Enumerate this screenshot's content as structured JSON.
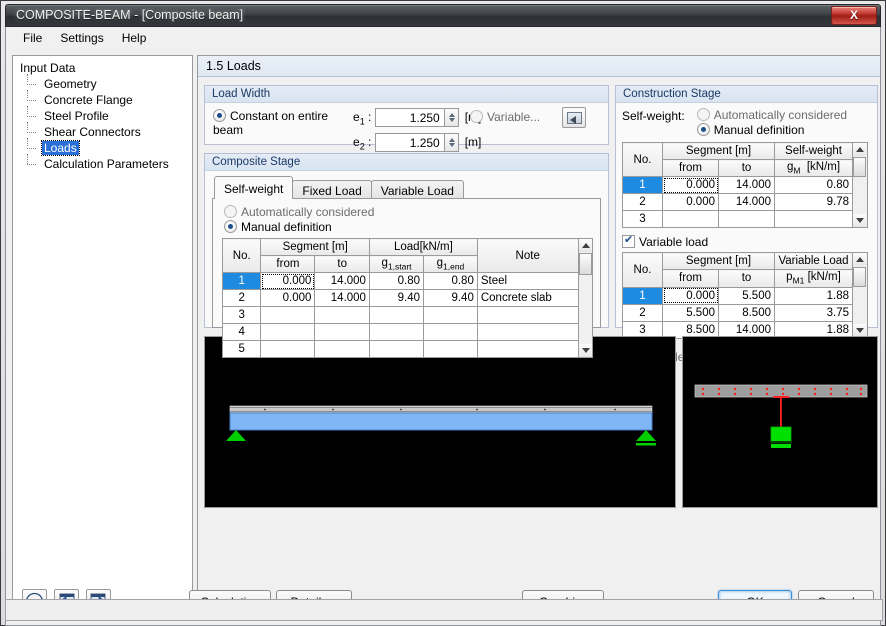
{
  "window": {
    "title": "COMPOSITE-BEAM - [Composite beam]",
    "close_label": "X"
  },
  "menu": {
    "items": [
      "File",
      "Settings",
      "Help"
    ]
  },
  "sidebar": {
    "root": "Input Data",
    "items": [
      {
        "label": "Geometry",
        "selected": false
      },
      {
        "label": "Concrete Flange",
        "selected": false
      },
      {
        "label": "Steel Profile",
        "selected": false
      },
      {
        "label": "Shear Connectors",
        "selected": false
      },
      {
        "label": "Loads",
        "selected": true
      },
      {
        "label": "Calculation Parameters",
        "selected": false
      }
    ]
  },
  "page": {
    "header": "1.5 Loads"
  },
  "load_width": {
    "title": "Load Width",
    "constant_label": "Constant on entire beam",
    "constant_selected": true,
    "e1_label": "e",
    "e1_sub": "1",
    "e1_colon": ":",
    "e1_value": "1.250",
    "e1_unit": "[m]",
    "e2_label": "e",
    "e2_sub": "2",
    "e2_colon": ":",
    "e2_value": "1.250",
    "e2_unit": "[m]",
    "variable_label": "Variable...",
    "variable_selected": false,
    "picker_icon": "picker-icon"
  },
  "composite_stage": {
    "title": "Composite Stage",
    "tabs": [
      {
        "label": "Self-weight",
        "active": true
      },
      {
        "label": "Fixed Load",
        "active": false
      },
      {
        "label": "Variable Load",
        "active": false
      }
    ],
    "auto_label": "Automatically considered",
    "auto_selected": false,
    "manual_label": "Manual definition",
    "manual_selected": true,
    "table": {
      "group_headers": [
        "Segment [m]",
        "Load[kN/m]"
      ],
      "headers": {
        "no": "No.",
        "from": "from",
        "to": "to",
        "g_start_main": "g",
        "g_start_sub": "1,start",
        "g_end_main": "g",
        "g_end_sub": "1,end",
        "note": "Note"
      },
      "rows": [
        {
          "no": "1",
          "from": "0.000",
          "to": "14.000",
          "g_start": "0.80",
          "g_end": "0.80",
          "note": "Steel",
          "selected": true
        },
        {
          "no": "2",
          "from": "0.000",
          "to": "14.000",
          "g_start": "9.40",
          "g_end": "9.40",
          "note": "Concrete slab",
          "selected": false
        },
        {
          "no": "3",
          "from": "",
          "to": "",
          "g_start": "",
          "g_end": "",
          "note": "",
          "selected": false
        },
        {
          "no": "4",
          "from": "",
          "to": "",
          "g_start": "",
          "g_end": "",
          "note": "",
          "selected": false
        },
        {
          "no": "5",
          "from": "",
          "to": "",
          "g_start": "",
          "g_end": "",
          "note": "",
          "selected": false
        }
      ]
    }
  },
  "construction_stage": {
    "title": "Construction Stage",
    "self_weight_label": "Self-weight:",
    "auto_label": "Automatically considered",
    "auto_selected": false,
    "manual_label": "Manual definition",
    "manual_selected": true,
    "table": {
      "group_headers": [
        "Segment [m]",
        "Self-weight"
      ],
      "headers": {
        "no": "No.",
        "from": "from",
        "to": "to",
        "g_main": "g",
        "g_sub": "M",
        "g_unit": "[kN/m]"
      },
      "rows": [
        {
          "no": "1",
          "from": "0.000",
          "to": "14.000",
          "value": "0.80",
          "selected": true
        },
        {
          "no": "2",
          "from": "0.000",
          "to": "14.000",
          "value": "9.78",
          "selected": false
        },
        {
          "no": "3",
          "from": "",
          "to": "",
          "value": "",
          "selected": false
        }
      ]
    },
    "variable_load_label": "Variable load",
    "variable_load_checked": true,
    "variable_table": {
      "group_headers": [
        "Segment [m]",
        "Variable Load"
      ],
      "headers": {
        "no": "No.",
        "from": "from",
        "to": "to",
        "p_main": "p",
        "p_sub": "M1",
        "p_unit": "[kN/m]"
      },
      "rows": [
        {
          "no": "1",
          "from": "0.000",
          "to": "5.500",
          "value": "1.88",
          "selected": true
        },
        {
          "no": "2",
          "from": "5.500",
          "to": "8.500",
          "value": "3.75",
          "selected": false
        },
        {
          "no": "3",
          "from": "8.500",
          "to": "14.000",
          "value": "1.88",
          "selected": false
        }
      ]
    },
    "movable_load_label": "Movable load...",
    "movable_load_checked": false,
    "movable_picker_icon": "picker-icon"
  },
  "graphics": {
    "beam_view_name": "beam-elevation-view",
    "section_view_name": "beam-cross-section-view"
  },
  "footer": {
    "help_icon": "help-icon",
    "prev_icon": "previous-page-icon",
    "next_icon": "next-page-icon",
    "calculation_label": "Calculation",
    "details_label": "Details...",
    "graphics_label": "Graphics",
    "ok_label": "OK",
    "cancel_label": "Cancel"
  },
  "colors": {
    "selection_blue": "#1e8ae0",
    "tree_selection": "#2a6fd6",
    "group_title_text": "#1a3a66",
    "beam_fill": "#7fb6f5",
    "support_green": "#00d000",
    "section_slab": "#9e9e9e",
    "section_load_red": "#ff2020"
  }
}
